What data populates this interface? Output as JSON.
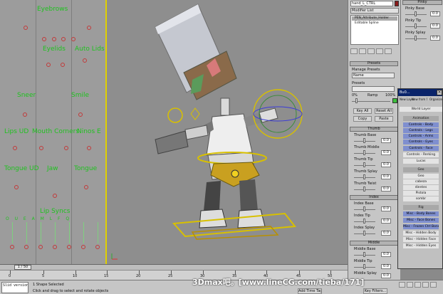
{
  "schematic": {
    "labels": [
      "Eyebrows",
      "Eyelids",
      "Auto Lids",
      "Sneer",
      "Smile",
      "Lips UD",
      "Mouth Corners",
      "Ninos E",
      "Tongue UD",
      "Jaw",
      "Tongue",
      "Lip Syncs",
      "O U E A M L F Q"
    ]
  },
  "viewport": {
    "label": "Perspective"
  },
  "modifier_panel": {
    "object_name": "hand_L_CTRL",
    "modifier_list": "Modifier List",
    "stack": [
      "PEN_Attribute_Holder",
      "Editable Spline"
    ]
  },
  "pinky": {
    "title": "Pinky",
    "params": [
      {
        "label": "Pinky Base",
        "value": "0.0"
      },
      {
        "label": "Pinky Tip",
        "value": "0.0"
      },
      {
        "label": "Pinky Splay",
        "value": "0.0"
      }
    ]
  },
  "presets": {
    "title": "Presets",
    "manage": "Manage Presets",
    "name_label": "Name",
    "presets_label": "Presets",
    "pct_start": "0%",
    "ramp": "Ramp",
    "pct_end": "100%",
    "key_all": "Key All",
    "reset_all": "Reset All",
    "copy": "Copy",
    "paste": "Paste"
  },
  "thumb": {
    "title": "Thumb",
    "params": [
      {
        "label": "Thumb Base",
        "value": "0.0"
      },
      {
        "label": "Thumb Middle",
        "value": "0.0"
      },
      {
        "label": "Thumb Tip",
        "value": "0.0"
      },
      {
        "label": "Thumb Splay",
        "value": "0.0"
      },
      {
        "label": "Thumb Twist",
        "value": "0.0"
      }
    ]
  },
  "index": {
    "title": "Index",
    "params": [
      {
        "label": "Index Base",
        "value": "0.0"
      },
      {
        "label": "Index Tip",
        "value": "0.0"
      },
      {
        "label": "Index Splay",
        "value": "0.0"
      }
    ]
  },
  "middle": {
    "title": "Middle",
    "params": [
      {
        "label": "Middle Base",
        "value": "0.0"
      },
      {
        "label": "Middle Tip",
        "value": "0.0"
      },
      {
        "label": "Middle Splay",
        "value": "0.0"
      }
    ]
  },
  "layer_window": {
    "title": "Bu0...",
    "tabs": [
      "New Layer",
      "New from Selection",
      "Organize"
    ],
    "world": "World Layer",
    "animation_header": "Animation",
    "animation_rows": [
      "Controls - Body",
      "Controls - Legs",
      "Controls - Arms",
      "Controls - Eyes",
      "Controls - Face",
      "Controls - Rerking",
      "Lucas"
    ],
    "geo_header": "Geo",
    "geo_rows": [
      "Geo",
      "cabeza",
      "dientes",
      "Pistola",
      "sombr"
    ],
    "rig_header": "Rig",
    "rig_rows": [
      "Misc - Body Bones",
      "Misc - Face Bones",
      "Misc - Frozen Ctrl Bones",
      "Misc - Hidden Body",
      "Misc - Hidden Face",
      "Misc - Hidden Eyes"
    ]
  },
  "timeline": {
    "frame": "1 / 50",
    "ticks": [
      "0",
      "5",
      "10",
      "15",
      "20",
      "25",
      "30",
      "35",
      "40",
      "45",
      "50"
    ]
  },
  "status": {
    "script": "Slid version 0",
    "selected": "1 Shape Selected",
    "prompt": "Click and drag to select and rotate objects",
    "add_time_tag": "Add Time Tag",
    "key_filters": "Key Filters..."
  },
  "watermark": "3Dmax吧。[www.lineCG.com/tieba/171]"
}
